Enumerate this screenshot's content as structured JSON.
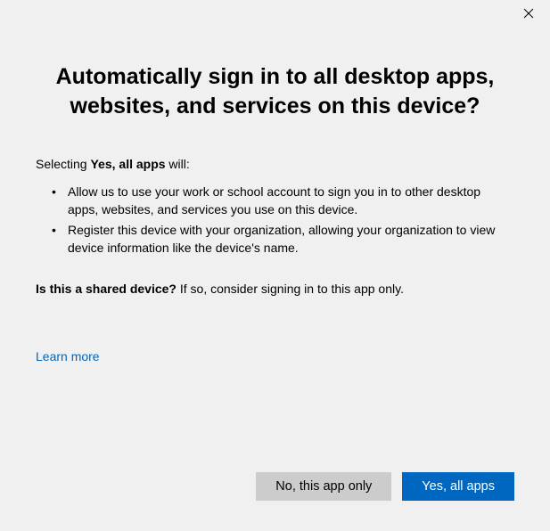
{
  "heading": "Automatically sign in to all desktop apps, websites, and services on this device?",
  "intro": {
    "prefix": "Selecting ",
    "bold": "Yes, all apps",
    "suffix": " will:"
  },
  "bullets": [
    "Allow us to use your work or school account to sign you in to other desktop apps, websites, and services you use on this device.",
    "Register this device with your organization, allowing your organization to view device information like the device's name."
  ],
  "shared": {
    "bold": "Is this a shared device?",
    "rest": " If so, consider signing in to this app only."
  },
  "learn_more": "Learn more",
  "buttons": {
    "secondary": "No, this app only",
    "primary": "Yes, all apps"
  }
}
